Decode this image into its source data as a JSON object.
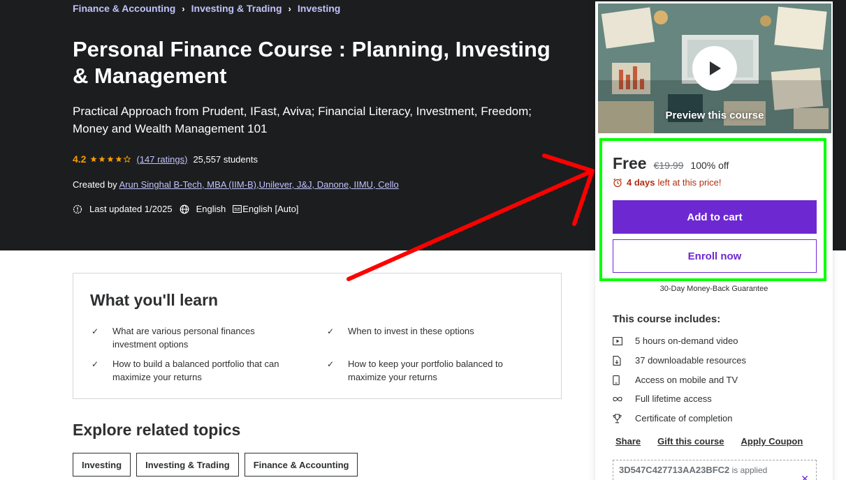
{
  "breadcrumb": [
    "Finance & Accounting",
    "Investing & Trading",
    "Investing"
  ],
  "title": "Personal Finance Course : Planning, Investing & Management",
  "subtitle": "Practical Approach from Prudent, IFast, Aviva; Financial Literacy, Investment, Freedom; Money and Wealth Management 101",
  "rating": {
    "value": "4.2",
    "stars": 4.2,
    "ratings_text": "(147 ratings)",
    "students_text": "25,557 students"
  },
  "created": {
    "label": "Created by",
    "author": "Arun Singhal B-Tech, MBA (IIM-B),Unilever, J&J, Danone, IIMU, Cello"
  },
  "meta": {
    "updated": "Last updated 1/2025",
    "language": "English",
    "captions": "English [Auto]"
  },
  "learn": {
    "title": "What you'll learn",
    "items": [
      "What are various personal finances investment options",
      "When to invest in these options",
      "How to build a balanced portfolio that can maximize your returns",
      "How to keep your portfolio balanced to maximize your returns"
    ]
  },
  "explore": {
    "title": "Explore related topics",
    "topics": [
      "Investing",
      "Investing & Trading",
      "Finance & Accounting"
    ]
  },
  "sidebar": {
    "preview_label": "Preview this course",
    "price": "Free",
    "original_price": "€19.99",
    "discount": "100% off",
    "timer_bold": "4 days",
    "timer_rest": "left at this price!",
    "add_to_cart": "Add to cart",
    "enroll_now": "Enroll now",
    "guarantee": "30-Day Money-Back Guarantee",
    "includes_title": "This course includes:",
    "includes": [
      {
        "icon": "video-icon",
        "text": "5 hours on-demand video"
      },
      {
        "icon": "file-download-icon",
        "text": "37 downloadable resources"
      },
      {
        "icon": "mobile-icon",
        "text": "Access on mobile and TV"
      },
      {
        "icon": "infinity-icon",
        "text": "Full lifetime access"
      },
      {
        "icon": "trophy-icon",
        "text": "Certificate of completion"
      }
    ],
    "links": [
      "Share",
      "Gift this course",
      "Apply Coupon"
    ],
    "coupon_code": "3D547C427713AA23BFC2",
    "coupon_status": "is applied"
  },
  "colors": {
    "hero_bg": "#1c1d1f",
    "accent": "#6d28d2",
    "link": "#c0c4fc",
    "rating": "#f69c08",
    "timer": "#b32d0f",
    "highlight": "#00ff00",
    "arrow": "#ff0000"
  }
}
